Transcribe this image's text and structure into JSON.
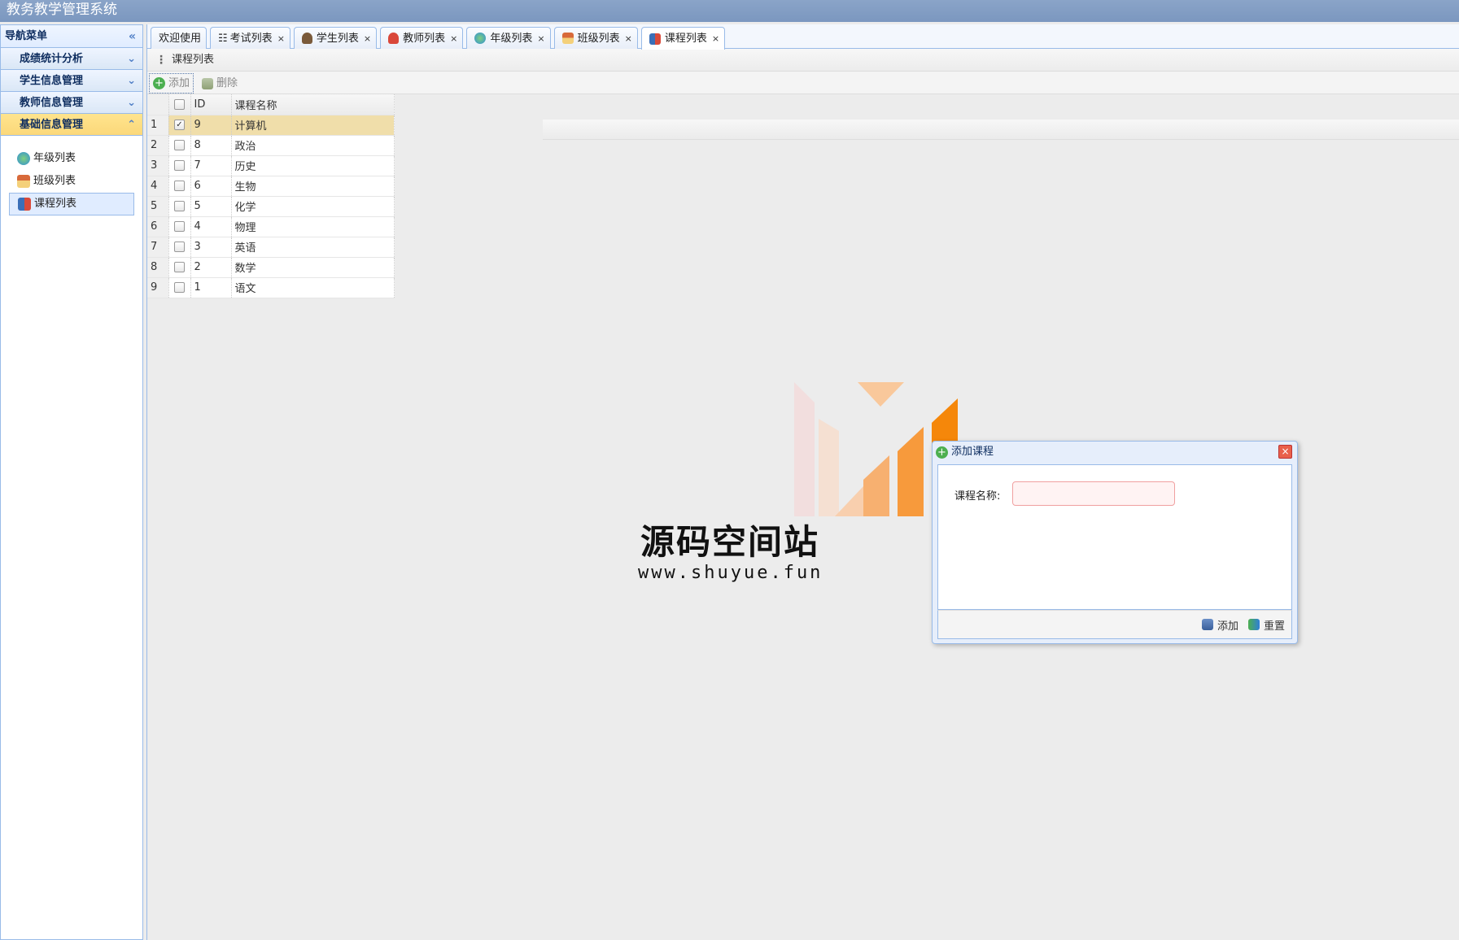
{
  "app": {
    "title": "教务教学管理系统"
  },
  "sidebar": {
    "header": "导航菜单",
    "panels": [
      {
        "label": "成绩统计分析"
      },
      {
        "label": "学生信息管理"
      },
      {
        "label": "教师信息管理"
      },
      {
        "label": "基础信息管理"
      }
    ],
    "tree": [
      {
        "label": "年级列表",
        "icon": "globe-icon"
      },
      {
        "label": "班级列表",
        "icon": "house-icon"
      },
      {
        "label": "课程列表",
        "icon": "book-icon"
      }
    ]
  },
  "tabs": [
    {
      "label": "欢迎使用",
      "icon": ""
    },
    {
      "label": "考试列表",
      "icon": "list-icon"
    },
    {
      "label": "学生列表",
      "icon": "student-icon"
    },
    {
      "label": "教师列表",
      "icon": "teacher-icon"
    },
    {
      "label": "年级列表",
      "icon": "globe-icon"
    },
    {
      "label": "班级列表",
      "icon": "house-icon"
    },
    {
      "label": "课程列表",
      "icon": "book-icon"
    }
  ],
  "panel": {
    "title": "课程列表"
  },
  "toolbar": {
    "add_label": "添加",
    "delete_label": "删除"
  },
  "grid": {
    "columns": [
      "ID",
      "课程名称"
    ],
    "rows": [
      {
        "n": "1",
        "id": "9",
        "name": "计算机",
        "checked": true
      },
      {
        "n": "2",
        "id": "8",
        "name": "政治",
        "checked": false
      },
      {
        "n": "3",
        "id": "7",
        "name": "历史",
        "checked": false
      },
      {
        "n": "4",
        "id": "6",
        "name": "生物",
        "checked": false
      },
      {
        "n": "5",
        "id": "5",
        "name": "化学",
        "checked": false
      },
      {
        "n": "6",
        "id": "4",
        "name": "物理",
        "checked": false
      },
      {
        "n": "7",
        "id": "3",
        "name": "英语",
        "checked": false
      },
      {
        "n": "8",
        "id": "2",
        "name": "数学",
        "checked": false
      },
      {
        "n": "9",
        "id": "1",
        "name": "语文",
        "checked": false
      }
    ]
  },
  "watermark": {
    "name": "源码空间站",
    "url": "www.shuyue.fun"
  },
  "dialog": {
    "title": "添加课程",
    "field_label": "课程名称:",
    "field_value": "",
    "add_label": "添加",
    "reset_label": "重置"
  },
  "colors": {
    "accent": "#99bbe8",
    "active_panel": "#fbd87a",
    "selected_row": "#f0deaa",
    "watermark_orange": "#f5870a"
  }
}
